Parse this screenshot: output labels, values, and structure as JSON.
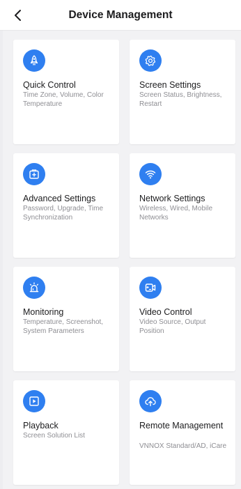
{
  "header": {
    "title": "Device Management",
    "back_icon": "chevron-left-icon"
  },
  "accent_color": "#2f7ff0",
  "cards": [
    {
      "title": "Quick Control",
      "desc": "Time Zone, Volume, Color Temperature",
      "icon": "rocket-icon"
    },
    {
      "title": "Screen Settings",
      "desc": "Screen Status, Brightness, Restart",
      "icon": "gear-icon"
    },
    {
      "title": "Advanced Settings",
      "desc": "Password, Upgrade, Time Synchronization",
      "icon": "toolbox-icon"
    },
    {
      "title": "Network Settings",
      "desc": "Wireless, Wired, Mobile Networks",
      "icon": "wifi-icon"
    },
    {
      "title": "Monitoring",
      "desc": "Temperature, Screenshot, System Parameters",
      "icon": "alarm-light-icon"
    },
    {
      "title": "Video Control",
      "desc": "Video Source, Output Position",
      "icon": "video-source-icon"
    },
    {
      "title": "Playback",
      "desc": "Screen Solution List",
      "icon": "play-icon"
    },
    {
      "title": "Remote Management",
      "desc": "VNNOX Standard/AD, iCare",
      "icon": "cloud-upload-icon"
    }
  ]
}
